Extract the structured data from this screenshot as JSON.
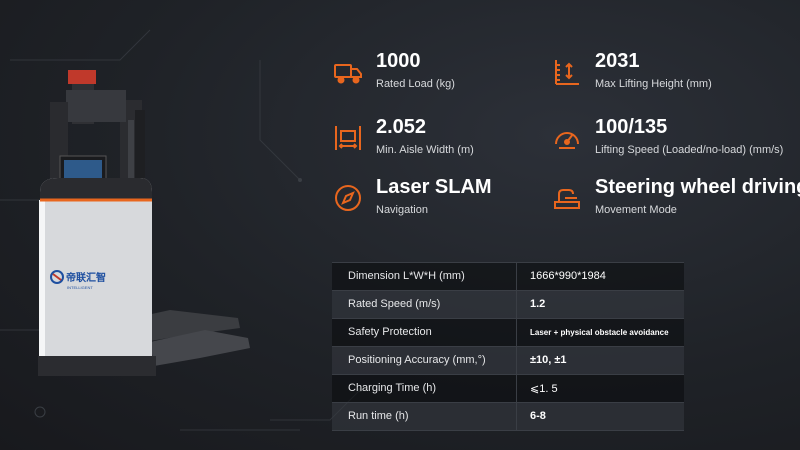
{
  "colors": {
    "accent": "#e8661e",
    "background": "#1f2227"
  },
  "brand": {
    "logo_text": "帝联汇智",
    "logo_subtext": "INTELLIGENT"
  },
  "specs": [
    {
      "icon": "truck-icon",
      "value": "1000",
      "label": "Rated Load (kg)"
    },
    {
      "icon": "height-ruler-icon",
      "value": "2031",
      "label": "Max Lifting Height (mm)"
    },
    {
      "icon": "aisle-width-icon",
      "value": "2.052",
      "label": "Min. Aisle Width (m)"
    },
    {
      "icon": "speedometer-icon",
      "value": "100/135",
      "label": "Lifting Speed (Loaded/no-load) (mm/s)"
    },
    {
      "icon": "compass-icon",
      "value": "Laser SLAM",
      "label": "Navigation"
    },
    {
      "icon": "steering-wheel-icon",
      "value": "Steering wheel driving",
      "label": "Movement Mode"
    }
  ],
  "table": [
    {
      "key": "Dimension L*W*H (mm)",
      "value": "1666*990*1984"
    },
    {
      "key": "Rated Speed (m/s)",
      "value": "1.2"
    },
    {
      "key": "Safety Protection",
      "value": "Laser + physical obstacle avoidance"
    },
    {
      "key": "Positioning Accuracy (mm,°)",
      "value": "±10, ±1"
    },
    {
      "key": "Charging Time (h)",
      "value": "⩽1. 5"
    },
    {
      "key": "Run time (h)",
      "value": "6-8"
    }
  ]
}
